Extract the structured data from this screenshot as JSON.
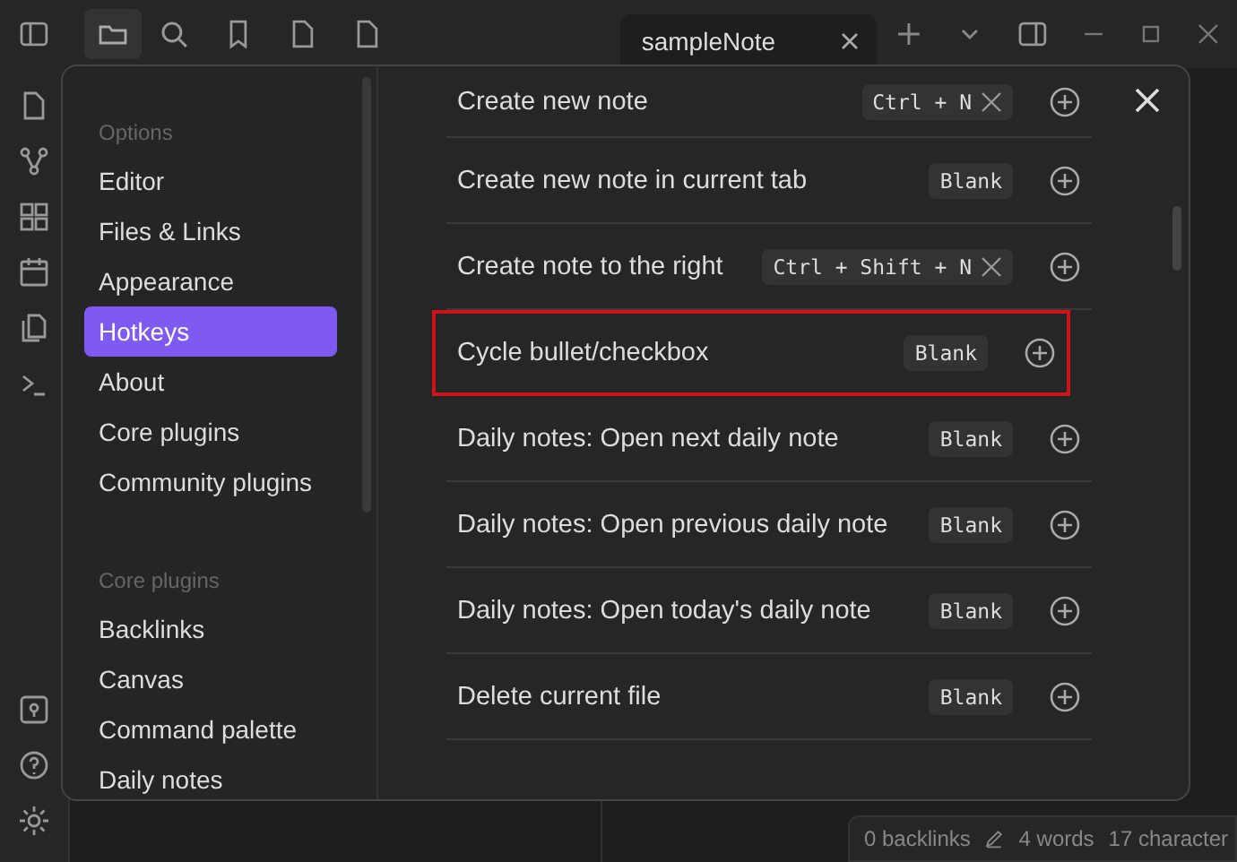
{
  "top_bar": {
    "tab": {
      "title": "sampleNote",
      "selected": true
    }
  },
  "settings": {
    "sidebar": {
      "sections": [
        {
          "heading": "Options",
          "items": [
            {
              "label": "Editor",
              "selected": false
            },
            {
              "label": "Files & Links",
              "selected": false
            },
            {
              "label": "Appearance",
              "selected": false
            },
            {
              "label": "Hotkeys",
              "selected": true
            },
            {
              "label": "About",
              "selected": false
            },
            {
              "label": "Core plugins",
              "selected": false
            },
            {
              "label": "Community plugins",
              "selected": false
            }
          ]
        },
        {
          "heading": "Core plugins",
          "items": [
            {
              "label": "Backlinks",
              "selected": false
            },
            {
              "label": "Canvas",
              "selected": false
            },
            {
              "label": "Command palette",
              "selected": false
            },
            {
              "label": "Daily notes",
              "selected": false
            }
          ]
        }
      ]
    },
    "hotkeys": [
      {
        "command": "Create new note",
        "hotkey": "Ctrl + N",
        "kind": "assigned",
        "highlighted": false
      },
      {
        "command": "Create new note in current tab",
        "hotkey": "Blank",
        "kind": "blank",
        "highlighted": false
      },
      {
        "command": "Create note to the right",
        "hotkey": "Ctrl + Shift + N",
        "kind": "assigned",
        "highlighted": false
      },
      {
        "command": "Cycle bullet/checkbox",
        "hotkey": "Blank",
        "kind": "blank",
        "highlighted": true
      },
      {
        "command": "Daily notes: Open next daily note",
        "hotkey": "Blank",
        "kind": "blank",
        "highlighted": false
      },
      {
        "command": "Daily notes: Open previous daily note",
        "hotkey": "Blank",
        "kind": "blank",
        "highlighted": false
      },
      {
        "command": "Daily notes: Open today's daily note",
        "hotkey": "Blank",
        "kind": "blank",
        "highlighted": false
      },
      {
        "command": "Delete current file",
        "hotkey": "Blank",
        "kind": "blank",
        "highlighted": false
      }
    ]
  },
  "status_bar": {
    "backlinks": "0 backlinks",
    "words": "4 words",
    "characters": "17 character"
  }
}
